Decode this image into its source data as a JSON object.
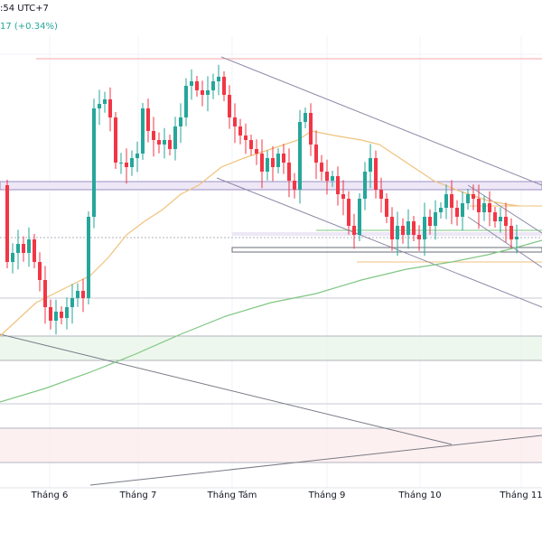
{
  "header": {
    "time_fragment": ":54 UTC+7",
    "change_fragment": "17 (+0.34%)"
  },
  "colors": {
    "up": "#26a69a",
    "down": "#f23645",
    "ma_fast": "#f0c27b",
    "ma_slow": "#81c784",
    "zone_support": "#e8f5e9",
    "zone_red": "#fdecec",
    "band": "#b39ddb"
  },
  "chart_data": {
    "type": "candlestick",
    "title": "",
    "xlabel": "",
    "ylabel": "",
    "x_tick_labels": [
      "Tháng 6",
      "Tháng 7",
      "Tháng Tám",
      "Tháng 9",
      "Tháng 10",
      "Tháng 11"
    ],
    "first_open": 39.5,
    "closes": [
      31,
      32,
      33,
      32,
      33.5,
      31,
      29,
      26,
      24.5,
      25.5,
      24.8,
      26,
      27,
      27.8,
      27,
      36,
      48,
      48.5,
      49,
      47,
      42,
      42,
      41.5,
      42.5,
      43,
      48,
      45.5,
      44.5,
      44,
      44.5,
      43.5,
      46,
      47,
      50.5,
      51,
      50,
      49.5,
      50,
      51,
      51.5,
      49.5,
      47,
      46,
      45,
      44.5,
      43.5,
      43,
      41,
      42.5,
      41.5,
      43,
      42,
      40,
      39,
      46.5,
      47.5,
      44,
      42,
      41,
      40,
      40.5,
      38.5,
      38,
      35,
      34,
      38,
      41,
      42.5,
      39,
      38,
      36,
      33.5,
      35,
      34,
      35.5,
      34,
      33.5,
      36,
      35,
      36.5,
      37,
      38.5,
      37,
      36,
      37.5,
      38.5,
      38,
      36.5,
      37.5,
      36.5,
      35.5,
      36,
      35,
      33.5,
      33.8
    ],
    "ylim": [
      0,
      60
    ],
    "grid": true
  }
}
